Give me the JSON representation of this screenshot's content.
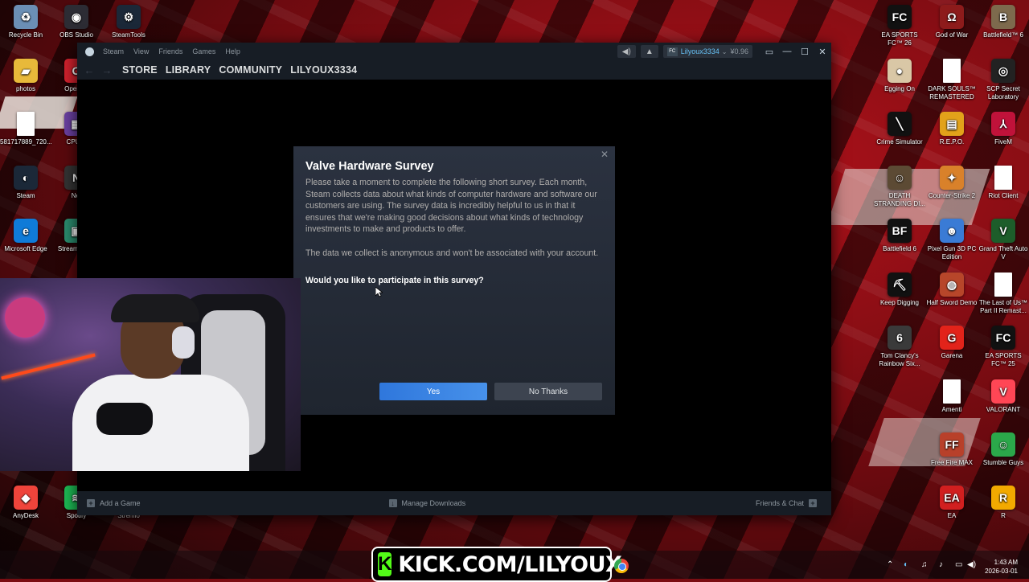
{
  "desktop": {
    "left_icons": [
      {
        "label": "Recycle Bin",
        "icon": "recycle-bin-icon",
        "color": "#6b8fb5",
        "glyph": "♻"
      },
      {
        "label": "OBS Studio",
        "icon": "obs-icon",
        "color": "#2c2c34",
        "glyph": "◉"
      },
      {
        "label": "SteamTools",
        "icon": "steamtools-icon",
        "color": "#1b2838",
        "glyph": "⚙"
      },
      {
        "label": "photos",
        "icon": "folder-icon",
        "color": "#e8b93a",
        "glyph": "▰"
      },
      {
        "label": "Opera B",
        "icon": "opera-icon",
        "color": "#d0212d",
        "glyph": "O"
      },
      {
        "label": "581717889_720...",
        "icon": "file-icon",
        "color": "#ffffff",
        "glyph": ""
      },
      {
        "label": "CPUID",
        "icon": "cpuid-icon",
        "color": "#6a3fa0",
        "glyph": "▦"
      },
      {
        "label": "Steam",
        "icon": "steam-icon",
        "color": "#1b2838",
        "glyph": "◐"
      },
      {
        "label": "Net",
        "icon": "net-icon",
        "color": "#333",
        "glyph": "N"
      },
      {
        "label": "Microsoft Edge",
        "icon": "edge-icon",
        "color": "#0f7bd8",
        "glyph": "e"
      },
      {
        "label": "Stream Desk",
        "icon": "stream-deck-icon",
        "color": "#2a8a6c",
        "glyph": "▣"
      },
      {
        "label": "AnyDesk",
        "icon": "anydesk-icon",
        "color": "#ef443b",
        "glyph": "◆"
      },
      {
        "label": "Spotify",
        "icon": "spotify-icon",
        "color": "#1db954",
        "glyph": "≋"
      },
      {
        "label": "Stremio",
        "icon": "stremio-icon",
        "color": "#5b3fa0",
        "glyph": "▶"
      }
    ],
    "right_icons": [
      {
        "label": "EA SPORTS FC™ 26",
        "icon": "fc26-icon",
        "color": "#111",
        "glyph": "FC"
      },
      {
        "label": "God of War",
        "icon": "god-of-war-icon",
        "color": "#8d1b1b",
        "glyph": "Ω"
      },
      {
        "label": "Battlefield™ 6",
        "icon": "battlefield6-icon",
        "color": "#7d6a4d",
        "glyph": "B"
      },
      {
        "label": "Egging On",
        "icon": "egging-on-icon",
        "color": "#d9c7a6",
        "glyph": "●"
      },
      {
        "label": "DARK SOULS™ REMASTERED",
        "icon": "file-icon",
        "color": "#ffffff",
        "glyph": ""
      },
      {
        "label": "SCP Secret Laboratory",
        "icon": "scp-icon",
        "color": "#222",
        "glyph": "◎"
      },
      {
        "label": "Crime Simulator",
        "icon": "crime-simulator-icon",
        "color": "#111",
        "glyph": "╲"
      },
      {
        "label": "R.E.P.O.",
        "icon": "repo-icon",
        "color": "#e2a21a",
        "glyph": "▤"
      },
      {
        "label": "FiveM",
        "icon": "fivem-icon",
        "color": "#c0123a",
        "glyph": "⅄"
      },
      {
        "label": "DEATH STRANDING DI...",
        "icon": "death-stranding-icon",
        "color": "#5c4a34",
        "glyph": "☺"
      },
      {
        "label": "Counter-Strike 2",
        "icon": "cs2-icon",
        "color": "#d9812a",
        "glyph": "✦"
      },
      {
        "label": "Riot Client",
        "icon": "file-icon",
        "color": "#ffffff",
        "glyph": ""
      },
      {
        "label": "Battlefield 6",
        "icon": "bf-icon",
        "color": "#111",
        "glyph": "BF"
      },
      {
        "label": "Pixel Gun 3D PC Edition",
        "icon": "pixel-gun-icon",
        "color": "#3a7bd5",
        "glyph": "☻"
      },
      {
        "label": "Grand Theft Auto V",
        "icon": "gta-icon",
        "color": "#1d5d2a",
        "glyph": "V"
      },
      {
        "label": "Keep Digging",
        "icon": "keep-digging-icon",
        "color": "#111",
        "glyph": "⛏"
      },
      {
        "label": "Half Sword Demo",
        "icon": "half-sword-icon",
        "color": "#b7462a",
        "glyph": "◍"
      },
      {
        "label": "The Last of Us™ Part II Remast...",
        "icon": "file-icon",
        "color": "#ffffff",
        "glyph": ""
      },
      {
        "label": "Tom Clancy's Rainbow Six...",
        "icon": "rainbow-six-icon",
        "color": "#3a3a3a",
        "glyph": "6"
      },
      {
        "label": "Garena",
        "icon": "garena-icon",
        "color": "#e2231a",
        "glyph": "G"
      },
      {
        "label": "EA SPORTS FC™ 25",
        "icon": "fc25-icon",
        "color": "#111",
        "glyph": "FC"
      },
      {
        "label": "Amenti",
        "icon": "file-icon",
        "color": "#ffffff",
        "glyph": ""
      },
      {
        "label": "VALORANT",
        "icon": "valorant-icon",
        "color": "#ff4655",
        "glyph": "V"
      },
      {
        "label": "Free Fire MAX",
        "icon": "free-fire-icon",
        "color": "#b8402a",
        "glyph": "FF"
      },
      {
        "label": "Stumble Guys",
        "icon": "stumble-guys-icon",
        "color": "#2ba84a",
        "glyph": "☺"
      },
      {
        "label": "EA",
        "icon": "ea-icon",
        "color": "#d11f1f",
        "glyph": "EA"
      },
      {
        "label": "R",
        "icon": "rockstar-icon",
        "color": "#f2a900",
        "glyph": "R"
      }
    ]
  },
  "steam": {
    "title": "Steam",
    "menu": [
      "View",
      "Friends",
      "Games",
      "Help"
    ],
    "nav": [
      "STORE",
      "LIBRARY",
      "COMMUNITY",
      "LILYOUX3334"
    ],
    "account_name": "Lilyoux3334",
    "account_balance": "¥0.96",
    "avatar_text": "FC",
    "bottom": {
      "add_game": "Add a Game",
      "manage_downloads": "Manage Downloads",
      "friends_chat": "Friends & Chat"
    }
  },
  "dialog": {
    "title": "Valve Hardware Survey",
    "paragraph1": "Please take a moment to complete the following short survey. Each month, Steam collects data about what kinds of computer hardware and software our customers are using. The survey data is incredibly helpful to us in that it ensures that we're making good decisions about what kinds of technology investments to make and products to offer.",
    "paragraph2": "The data we collect is anonymous and won't be associated with your account.",
    "question": "Would you like to participate in this survey?",
    "yes_label": "Yes",
    "no_label": "No Thanks",
    "close_glyph": "✕"
  },
  "overlay": {
    "kick_text": "KICK.COM/LILYOUX",
    "kick_k": "K",
    "brand_color": "#53fc18"
  },
  "taskbar": {
    "time": "1:43 AM",
    "date": "2026-03-01"
  }
}
